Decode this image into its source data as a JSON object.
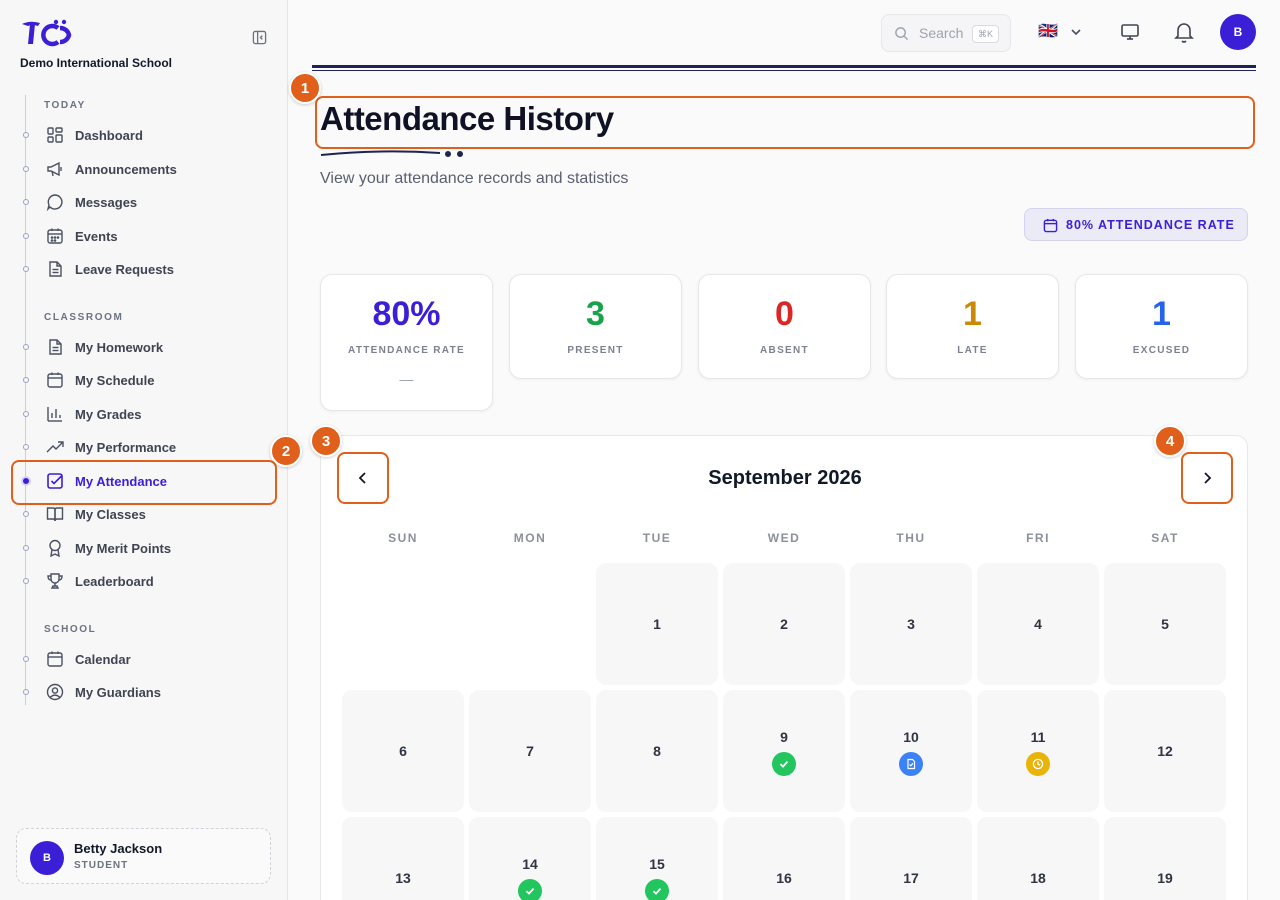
{
  "app": {
    "school_name": "Demo International School",
    "logo_icon": "school-logo-icon"
  },
  "sidebar": {
    "sections": [
      {
        "label": "TODAY",
        "items": [
          {
            "label": "Dashboard",
            "icon": "dashboard-icon"
          },
          {
            "label": "Announcements",
            "icon": "megaphone-icon"
          },
          {
            "label": "Messages",
            "icon": "chat-bubble-icon"
          },
          {
            "label": "Events",
            "icon": "calendar-grid-icon"
          },
          {
            "label": "Leave Requests",
            "icon": "document-icon"
          }
        ]
      },
      {
        "label": "CLASSROOM",
        "items": [
          {
            "label": "My Homework",
            "icon": "document-icon"
          },
          {
            "label": "My Schedule",
            "icon": "calendar-icon"
          },
          {
            "label": "My Grades",
            "icon": "bar-chart-icon"
          },
          {
            "label": "My Performance",
            "icon": "trend-up-icon"
          },
          {
            "label": "My Attendance",
            "icon": "checkbox-icon",
            "active": true
          },
          {
            "label": "My Classes",
            "icon": "book-icon"
          },
          {
            "label": "My Merit Points",
            "icon": "award-icon"
          },
          {
            "label": "Leaderboard",
            "icon": "trophy-icon"
          }
        ]
      },
      {
        "label": "SCHOOL",
        "items": [
          {
            "label": "Calendar",
            "icon": "calendar-icon"
          },
          {
            "label": "My Guardians",
            "icon": "user-circle-icon"
          }
        ]
      }
    ],
    "user": {
      "initial": "B",
      "name": "Betty Jackson",
      "role": "STUDENT"
    }
  },
  "topbar": {
    "search_placeholder": "Search",
    "search_shortcut": "⌘K",
    "language_flag": "🇬🇧",
    "avatar_initial": "B"
  },
  "header": {
    "title": "Attendance History",
    "subtitle": "View your attendance records and statistics",
    "rate_badge": "80% ATTENDANCE RATE"
  },
  "stats": [
    {
      "value": "80%",
      "label": "ATTENDANCE RATE",
      "color": "#3b1fd6",
      "extra": "—"
    },
    {
      "value": "3",
      "label": "PRESENT",
      "color": "#16a34a"
    },
    {
      "value": "0",
      "label": "ABSENT",
      "color": "#dc2626"
    },
    {
      "value": "1",
      "label": "LATE",
      "color": "#ca8a04"
    },
    {
      "value": "1",
      "label": "EXCUSED",
      "color": "#2563eb"
    }
  ],
  "calendar": {
    "month_label": "September 2026",
    "weekdays": [
      "SUN",
      "MON",
      "TUE",
      "WED",
      "THU",
      "FRI",
      "SAT"
    ],
    "days": [
      {
        "day": null
      },
      {
        "day": null
      },
      {
        "day": "1"
      },
      {
        "day": "2"
      },
      {
        "day": "3"
      },
      {
        "day": "4"
      },
      {
        "day": "5"
      },
      {
        "day": "6"
      },
      {
        "day": "7"
      },
      {
        "day": "8"
      },
      {
        "day": "9",
        "status": "present"
      },
      {
        "day": "10",
        "status": "excused"
      },
      {
        "day": "11",
        "status": "late"
      },
      {
        "day": "12"
      },
      {
        "day": "13"
      },
      {
        "day": "14",
        "status": "present"
      },
      {
        "day": "15",
        "status": "present"
      },
      {
        "day": "16"
      },
      {
        "day": "17"
      },
      {
        "day": "18"
      },
      {
        "day": "19"
      }
    ]
  },
  "annotations": [
    "1",
    "2",
    "3",
    "4"
  ],
  "colors": {
    "accent": "#3b1fd6",
    "highlight": "#e0601b",
    "present": "#22c55e",
    "excused": "#3b82f6",
    "late": "#eab308"
  }
}
